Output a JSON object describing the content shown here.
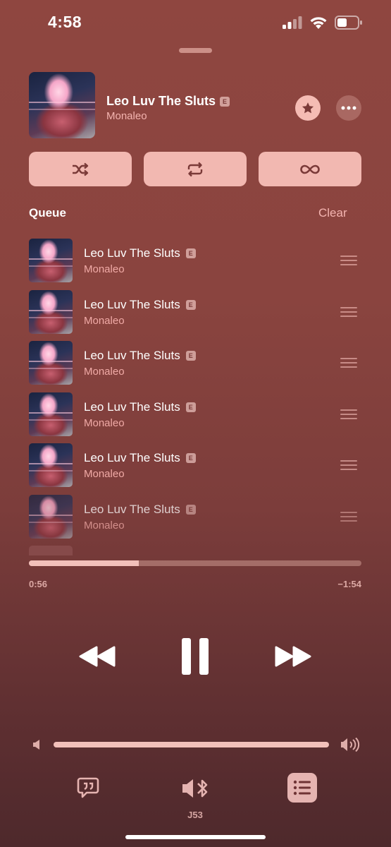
{
  "status_bar": {
    "time": "4:58",
    "icons": [
      "signal-icon",
      "wifi-icon",
      "battery-icon"
    ]
  },
  "now_playing": {
    "title": "Leo Luv The Sluts",
    "explicit_badge": "E",
    "artist": "Monaleo",
    "favorite_icon": "star-icon",
    "more_icon": "ellipsis-icon"
  },
  "modes": {
    "shuffle_icon": "shuffle-icon",
    "repeat_icon": "repeat-icon",
    "autoplay_icon": "infinity-icon"
  },
  "queue": {
    "label": "Queue",
    "clear_label": "Clear",
    "items": [
      {
        "title": "Leo Luv The Sluts",
        "badge": "E",
        "artist": "Monaleo"
      },
      {
        "title": "Leo Luv The Sluts",
        "badge": "E",
        "artist": "Monaleo"
      },
      {
        "title": "Leo Luv The Sluts",
        "badge": "E",
        "artist": "Monaleo"
      },
      {
        "title": "Leo Luv The Sluts",
        "badge": "E",
        "artist": "Monaleo"
      },
      {
        "title": "Leo Luv The Sluts",
        "badge": "E",
        "artist": "Monaleo"
      },
      {
        "title": "Leo Luv The Sluts",
        "badge": "E",
        "artist": "Monaleo"
      }
    ]
  },
  "playback": {
    "elapsed": "0:56",
    "remaining": "−1:54",
    "progress_fraction": 0.33
  },
  "controls": {
    "prev_icon": "rewind-icon",
    "play_pause_icon": "pause-icon",
    "next_icon": "fast-forward-icon"
  },
  "volume": {
    "level_fraction": 1.0
  },
  "bottom_bar": {
    "lyrics_icon": "lyrics-icon",
    "airplay_device": "J53",
    "queue_icon": "list-icon"
  },
  "colors": {
    "accent": "#f2b8b1",
    "background_top": "#8f4640",
    "background_bottom": "#4e292c"
  }
}
